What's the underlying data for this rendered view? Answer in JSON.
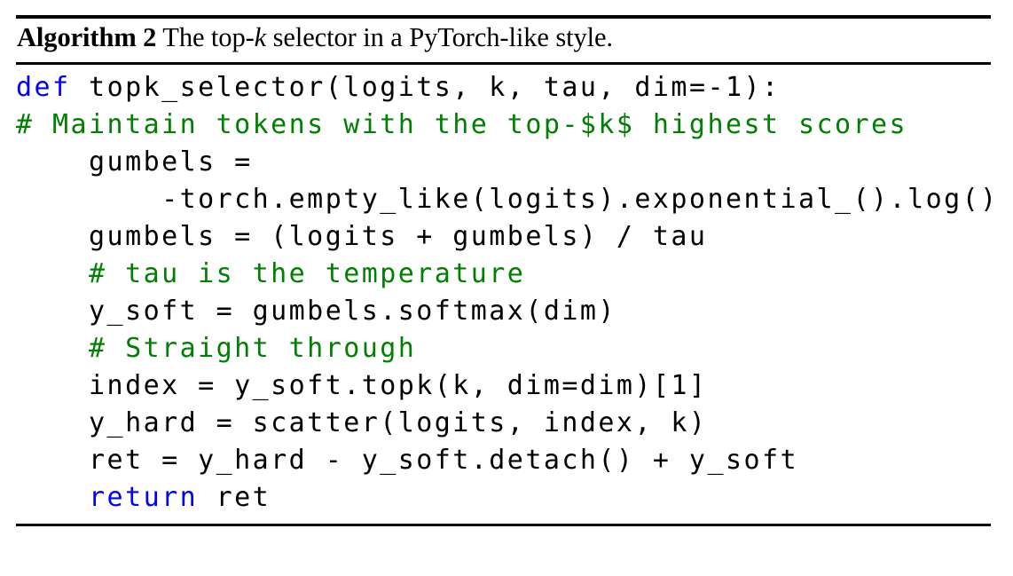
{
  "document": {
    "type": "algorithm-float",
    "background_color": "#ffffff",
    "rules": {
      "top_visible": true,
      "middle_visible": true,
      "bottom_visible": true
    }
  },
  "caption": {
    "label": "Algorithm 2",
    "text_before_math": " The top-",
    "math": "k",
    "text_after_math": " selector in a PyTorch-like style.",
    "full": "Algorithm 2 The top-k selector in a PyTorch-like style."
  },
  "colors": {
    "keyword": "#0000ff",
    "comment": "#008000",
    "plain": "#000000",
    "background": "#ffffff",
    "rule": "#000000"
  },
  "code": {
    "language": "python",
    "lines": [
      {
        "indent": "",
        "tokens": [
          {
            "kind": "keyword",
            "text": "def"
          },
          {
            "kind": "plain",
            "text": " topk_selector(logits, k, tau, dim=-1):"
          }
        ],
        "plain_text": "def topk_selector(logits, k, tau, dim=-1):"
      },
      {
        "indent": "",
        "tokens": [
          {
            "kind": "comment",
            "text": "# Maintain tokens with the top-$k$ highest scores"
          }
        ],
        "plain_text": "# Maintain tokens with the top-$k$ highest scores"
      },
      {
        "indent": "    ",
        "tokens": [
          {
            "kind": "plain",
            "text": "    gumbels ="
          }
        ],
        "plain_text": "    gumbels ="
      },
      {
        "indent": "        ",
        "tokens": [
          {
            "kind": "plain",
            "text": "        -torch.empty_like(logits).exponential_().log()"
          }
        ],
        "plain_text": "        -torch.empty_like(logits).exponential_().log()"
      },
      {
        "indent": "    ",
        "tokens": [
          {
            "kind": "plain",
            "text": "    gumbels = (logits + gumbels) / tau"
          }
        ],
        "plain_text": "    gumbels = (logits + gumbels) / tau"
      },
      {
        "indent": "    ",
        "tokens": [
          {
            "kind": "comment",
            "text": "    # tau is the temperature"
          }
        ],
        "plain_text": "    # tau is the temperature"
      },
      {
        "indent": "    ",
        "tokens": [
          {
            "kind": "plain",
            "text": "    y_soft = gumbels.softmax(dim)"
          }
        ],
        "plain_text": "    y_soft = gumbels.softmax(dim)"
      },
      {
        "indent": "    ",
        "tokens": [
          {
            "kind": "comment",
            "text": "    # Straight through"
          }
        ],
        "plain_text": "    # Straight through"
      },
      {
        "indent": "    ",
        "tokens": [
          {
            "kind": "plain",
            "text": "    index = y_soft.topk(k, dim=dim)[1]"
          }
        ],
        "plain_text": "    index = y_soft.topk(k, dim=dim)[1]"
      },
      {
        "indent": "    ",
        "tokens": [
          {
            "kind": "plain",
            "text": "    y_hard = scatter(logits, index, k)"
          }
        ],
        "plain_text": "    y_hard = scatter(logits, index, k)"
      },
      {
        "indent": "    ",
        "tokens": [
          {
            "kind": "plain",
            "text": "    ret = y_hard - y_soft.detach() + y_soft"
          }
        ],
        "plain_text": "    ret = y_hard - y_soft.detach() + y_soft"
      },
      {
        "indent": "    ",
        "tokens": [
          {
            "kind": "plain",
            "text": "    "
          },
          {
            "kind": "keyword",
            "text": "return"
          },
          {
            "kind": "plain",
            "text": " ret"
          }
        ],
        "plain_text": "    return ret"
      }
    ]
  }
}
